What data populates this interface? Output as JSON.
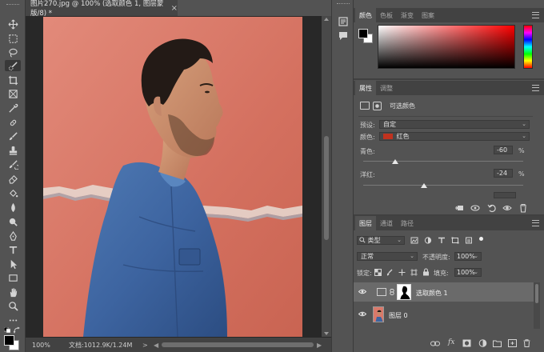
{
  "document": {
    "tab_title": "图片270.jpg @ 100% (选取颜色 1, 图层蒙版/8) *",
    "tab_close": "×",
    "status_zoom": "100%",
    "status_info": "文档:1012.9K/1.24M",
    "status_arrow": ">"
  },
  "toolbar": {
    "tools": [
      "move-tool",
      "marquee-tool",
      "lasso-tool",
      "quick-selection-tool",
      "crop-tool",
      "frame-tool",
      "eyedropper-tool",
      "healing-brush-tool",
      "brush-tool",
      "clone-stamp-tool",
      "history-brush-tool",
      "eraser-tool",
      "paint-bucket-tool",
      "blur-tool",
      "dodge-tool",
      "pen-tool",
      "type-tool",
      "path-selection-tool",
      "rectangle-tool",
      "hand-tool",
      "zoom-tool",
      "edit-toolbar"
    ],
    "active_tool": "quick-selection-tool",
    "foreground_color": "#000000",
    "background_color": "#ffffff"
  },
  "color_panel": {
    "tabs": [
      "颜色",
      "色板",
      "渐变",
      "图案"
    ],
    "active_tab": "颜色",
    "hue_color": "#ff0000"
  },
  "properties_panel": {
    "tabs": [
      "属性",
      "调整"
    ],
    "active_tab": "属性",
    "title": "可选颜色",
    "preset_label": "预设:",
    "preset_value": "自定",
    "colors_label": "颜色:",
    "colors_value": "红色",
    "colors_swatch": "#c0321e",
    "cyan_label": "青色:",
    "cyan_value": "-60",
    "cyan_fraction": 0.2,
    "magenta_label": "洋红:",
    "magenta_value": "-24",
    "magenta_fraction": 0.38,
    "percent": "%"
  },
  "layers_panel": {
    "tabs": [
      "图层",
      "通道",
      "路径"
    ],
    "active_tab": "图层",
    "filter_value": "类型",
    "blend_mode": "正常",
    "opacity_label": "不透明度:",
    "opacity_value": "100%",
    "lock_label": "锁定:",
    "fill_label": "填充:",
    "fill_value": "100%",
    "layers": [
      {
        "name": "选取颜色 1",
        "selected": true
      },
      {
        "name": "图层 0",
        "selected": false
      }
    ]
  },
  "icons": {
    "eye": "eye-icon",
    "link": "link-icon",
    "fx": "fx"
  }
}
